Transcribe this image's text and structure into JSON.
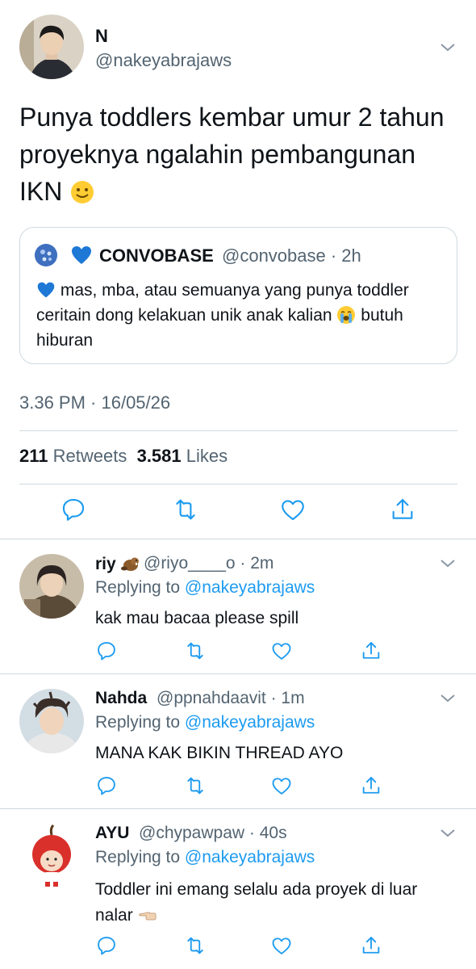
{
  "main_tweet": {
    "name": "N",
    "handle": "@nakeyabrajaws",
    "text": "Punya toddlers kembar umur 2 tahun proyeknya ngalahin pembangunan IKN",
    "text_emoji": "slightly-smiling-face-emoji",
    "quote": {
      "avatar": "convobase-avatar",
      "badge": "blue-heart-emoji",
      "name": "CONVOBASE",
      "handle_time": "@convobase · 2h",
      "text_part1": "mas, mba, atau semuanya yang punya toddler ceritain dong kelakuan unik anak kalian",
      "text_part2": "butuh hiburan",
      "lead_emoji": "blue-heart-emoji",
      "mid_emoji": "loudly-crying-face-emoji"
    },
    "timestamp": "3.36 PM · 16/05/26",
    "retweets_count": "211",
    "retweets_label": "Retweets",
    "likes_count": "3.581",
    "likes_label": "Likes"
  },
  "replies": [
    {
      "name": "riy",
      "name_emoji": "beaver-emoji",
      "handle_time": "@riyo____o · 2m",
      "replying_label": "Replying to",
      "replying_to": "@nakeyabrajaws",
      "text": "kak mau bacaa please spill"
    },
    {
      "name": "Nahda",
      "handle_time": "@ppnahdaavit · 1m",
      "replying_label": "Replying to",
      "replying_to": "@nakeyabrajaws",
      "text": "MANA KAK BIKIN THREAD AYO"
    },
    {
      "name": "AYU",
      "handle_time": "@chypawpaw · 40s",
      "replying_label": "Replying to",
      "replying_to": "@nakeyabrajaws",
      "text": "Toddler ini emang selalu ada proyek di luar nalar",
      "text_emoji": "left-pointing-hand-emoji"
    }
  ],
  "colors": {
    "text": "#0f1419",
    "secondary": "#536471",
    "link": "#1d9bf0",
    "border": "#cfd9de"
  },
  "icons": [
    "reply-icon",
    "retweet-icon",
    "like-icon",
    "share-icon",
    "chevron-down-icon"
  ]
}
